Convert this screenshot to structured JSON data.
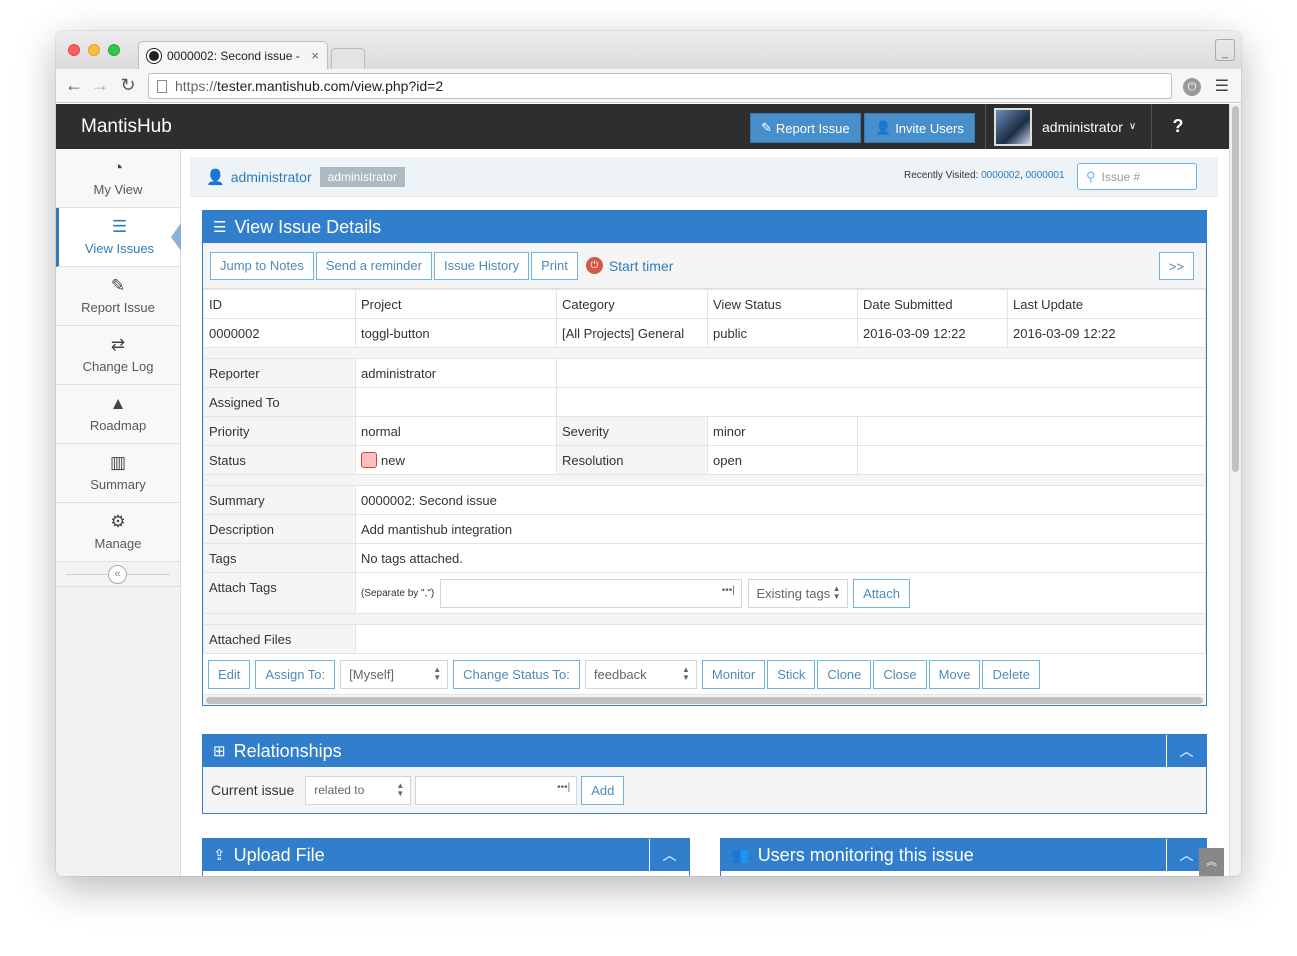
{
  "browser": {
    "tab_title": "0000002: Second issue - ",
    "tab_close": "×",
    "url_protocol": "https://",
    "url_rest": "tester.mantishub.com/view.php?id=2"
  },
  "navbar": {
    "brand": "MantisHub",
    "report_issue": "Report Issue",
    "invite_users": "Invite Users",
    "user": "administrator",
    "help": "?"
  },
  "sidebar": {
    "items": [
      {
        "label": "My View",
        "icon": "dashboard-icon"
      },
      {
        "label": "View Issues",
        "icon": "list-icon"
      },
      {
        "label": "Report Issue",
        "icon": "edit-icon"
      },
      {
        "label": "Change Log",
        "icon": "retweet-icon"
      },
      {
        "label": "Roadmap",
        "icon": "road-icon"
      },
      {
        "label": "Summary",
        "icon": "bar-chart-icon"
      },
      {
        "label": "Manage",
        "icon": "gears-icon"
      }
    ]
  },
  "breadcrumb": {
    "user": "administrator",
    "badge": "administrator",
    "recent_label": "Recently Visited: ",
    "recent_1": "0000002",
    "recent_sep": ", ",
    "recent_2": "0000001",
    "search_placeholder": "Issue #"
  },
  "details": {
    "title": "View Issue Details",
    "toolbar": [
      "Jump to Notes",
      "Send a reminder",
      "Issue History",
      "Print"
    ],
    "timer": "Start timer",
    "next": ">>",
    "headers": [
      "ID",
      "Project",
      "Category",
      "View Status",
      "Date Submitted",
      "Last Update"
    ],
    "values": [
      "0000002",
      "toggl-button",
      "[All Projects] General",
      "public",
      "2016-03-09 12:22",
      "2016-03-09 12:22"
    ],
    "reporter_label": "Reporter",
    "reporter": "administrator",
    "assigned_label": "Assigned To",
    "assigned": "",
    "priority_label": "Priority",
    "priority": "normal",
    "severity_label": "Severity",
    "severity": "minor",
    "status_label": "Status",
    "status": "new",
    "resolution_label": "Resolution",
    "resolution": "open",
    "summary_label": "Summary",
    "summary": "0000002: Second issue",
    "description_label": "Description",
    "description": "Add mantishub integration",
    "tags_label": "Tags",
    "tags": "No tags attached.",
    "attach_tags_label": "Attach Tags",
    "attach_tags_hint": "(Separate by \",\")",
    "existing_tags": "Existing tags",
    "attach_btn": "Attach",
    "files_label": "Attached Files",
    "status_color": "#f8c0c0"
  },
  "actions": {
    "edit": "Edit",
    "assign_to": "Assign To:",
    "assign_select": "[Myself]",
    "change_status": "Change Status To:",
    "status_select": "feedback",
    "monitor": "Monitor",
    "stick": "Stick",
    "clone": "Clone",
    "close": "Close",
    "move": "Move",
    "delete": "Delete"
  },
  "relationships": {
    "title": "Relationships",
    "current_issue": "Current issue",
    "relation_select": "related to",
    "add": "Add"
  },
  "upload": {
    "title": "Upload File"
  },
  "monitoring": {
    "title": "Users monitoring this issue"
  },
  "colors": {
    "accent": "#307ecc",
    "navbar": "#2e2e2e",
    "link": "#2b7dbc"
  }
}
